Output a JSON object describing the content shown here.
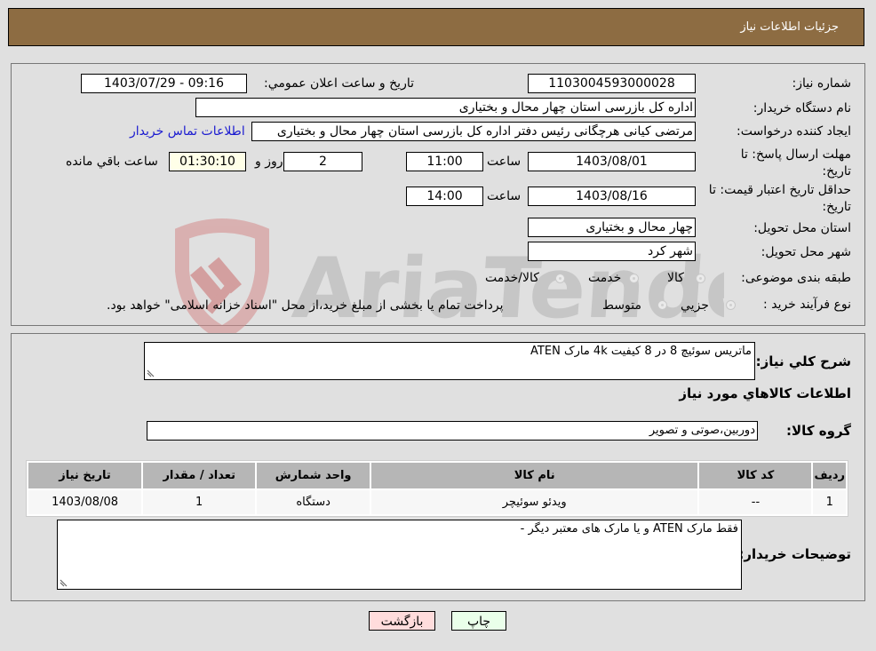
{
  "header": {
    "title": "جزئیات اطلاعات نیاز"
  },
  "fields": {
    "need_number": {
      "label": "شماره نیاز:",
      "value": "1103004593000028"
    },
    "announce_datetime": {
      "label": "تاریخ و ساعت اعلان عمومي:",
      "value": "1403/07/29 - 09:16"
    },
    "buyer_org": {
      "label": "نام دستگاه خریدار:",
      "value": "اداره کل بازرسی استان چهار محال و بختیاری"
    },
    "requester": {
      "label": "ایجاد کننده درخواست:",
      "value": "مرتضی کیانی هرچگانی رئیس دفتر اداره کل بازرسی استان چهار محال و بختیاری"
    },
    "contact_link": "اطلاعات تماس خریدار",
    "reply_deadline": {
      "label": "مهلت ارسال پاسخ: تا تاریخ:",
      "date": "1403/08/01",
      "time_label": "ساعت",
      "time": "11:00",
      "days": "2",
      "days_label": "روز و",
      "remaining": "01:30:10",
      "remaining_label": "ساعت باقي مانده"
    },
    "price_validity": {
      "label": "حداقل تاریخ اعتبار قیمت: تا تاریخ:",
      "date": "1403/08/16",
      "time_label": "ساعت",
      "time": "14:00"
    },
    "delivery_province": {
      "label": "استان محل تحویل:",
      "value": "چهار محال و بختیاری"
    },
    "delivery_city": {
      "label": "شهر محل تحویل:",
      "value": "شهر کرد"
    },
    "category": {
      "label": "طبقه بندی موضوعی:",
      "options": [
        "کالا",
        "خدمت",
        "کالا/خدمت"
      ]
    },
    "purchase_type": {
      "label": "نوع فرآیند خرید :",
      "options": [
        "جزیي",
        "متوسط"
      ],
      "note": "پرداخت تمام یا بخشی از مبلغ خرید،از محل \"اسناد خزانه اسلامی\" خواهد بود."
    }
  },
  "description": {
    "label": "شرح کلي نیاز:",
    "value": "ماتریس سوئیچ 8 در 8  کیفیت  4k مارک ATEN"
  },
  "goods_section_title": "اطلاعات کالاهاي مورد نیاز",
  "goods_group": {
    "label": "گروه کالا:",
    "value": "دوربین،صوتی و تصویر"
  },
  "table": {
    "headers": [
      "ردیف",
      "کد کالا",
      "نام کالا",
      "واحد شمارش",
      "تعداد / مقدار",
      "تاریخ نیاز"
    ],
    "rows": [
      [
        "1",
        "--",
        "ویدئو سوئیچر",
        "دستگاه",
        "1",
        "1403/08/08"
      ]
    ]
  },
  "buyer_notes": {
    "label": "توضیحات خریدار:",
    "value": "فقط مارک ATEN   و یا مارک های معتبر دیگر -"
  },
  "buttons": {
    "print": "چاپ",
    "back": "بازگشت"
  },
  "watermark": {
    "text": "AriaTender.neT"
  },
  "colors": {
    "header_bg": "#8d6c42",
    "print_btn": "#eaffea",
    "back_btn": "#ffdcdc",
    "link": "#1a1ad0"
  }
}
